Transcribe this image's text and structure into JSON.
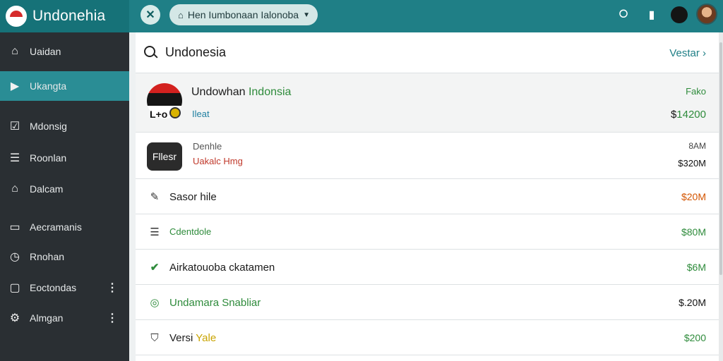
{
  "app": {
    "title": "Undonehia"
  },
  "topbar": {
    "location": "Hen Iumbonaan Ialonoba",
    "icons": [
      "close-icon",
      "home-icon",
      "chevron-down-icon",
      "settings-icon",
      "bookmark-icon",
      "dark-avatar",
      "user-avatar"
    ]
  },
  "sidebar": {
    "items": [
      {
        "label": "Uaidan",
        "icon": "home-icon"
      },
      {
        "label": "Ukangta",
        "icon": "play-icon",
        "active": true
      },
      {
        "label": "Mdonsig",
        "icon": "check-square-icon"
      },
      {
        "label": "Roonlan",
        "icon": "list-icon"
      },
      {
        "label": "Dalcam",
        "icon": "home-icon"
      },
      {
        "label": "Aecramanis",
        "icon": "folder-icon"
      },
      {
        "label": "Rnohan",
        "icon": "clock-icon"
      },
      {
        "label": "Eoctondas",
        "icon": "lock-icon",
        "dots": "⋮"
      },
      {
        "label": "Almgan",
        "icon": "settings-icon",
        "dots": "⋮"
      }
    ]
  },
  "main": {
    "search": "Undonesia",
    "view_link": "Vestar",
    "featured": {
      "title_prefix": "Undowhan",
      "title_suffix": "Indonsia",
      "subtitle": "Ileat",
      "flag_caption": "L+o",
      "status": "Fako",
      "amount_prefix": "$",
      "amount": "1420",
      "amount_suffix": "0"
    },
    "second": {
      "badge": "Fllesr",
      "title": "Denhle",
      "subtitle": "Uakalc Hmg",
      "time": "8AM",
      "amount": "$320M"
    },
    "rows": [
      {
        "icon": "edit-icon",
        "label": "Sasor hile",
        "amount": "$20M",
        "label_color": "#1b1b1b",
        "amount_color": "#d35400"
      },
      {
        "icon": "list-icon",
        "label": "Cdentdole",
        "amount": "$80M",
        "label_color": "#2e8b3b",
        "amount_color": "#2e8b3b"
      },
      {
        "icon": "check-icon",
        "label": "Airkatouoba ckatamen",
        "amount": "$6M",
        "label_color": "#1b1b1b",
        "amount_color": "#2e8b3b"
      },
      {
        "icon": "check-circle-icon",
        "label": "Undamara Snabliar",
        "amount": "$.20M",
        "label_color": "#2e8b3b",
        "amount_color": "#111111"
      },
      {
        "icon": "shield-icon",
        "label": "Versi",
        "label_suffix": "Yale",
        "amount": "$200",
        "label_color": "#1b1b1b",
        "amount_color": "#2e8b3b"
      }
    ]
  },
  "colors": {
    "topbar": "#1f7f86",
    "sidebar": "#2a2f33",
    "active": "#2a8d95",
    "green": "#2e8b3b"
  }
}
